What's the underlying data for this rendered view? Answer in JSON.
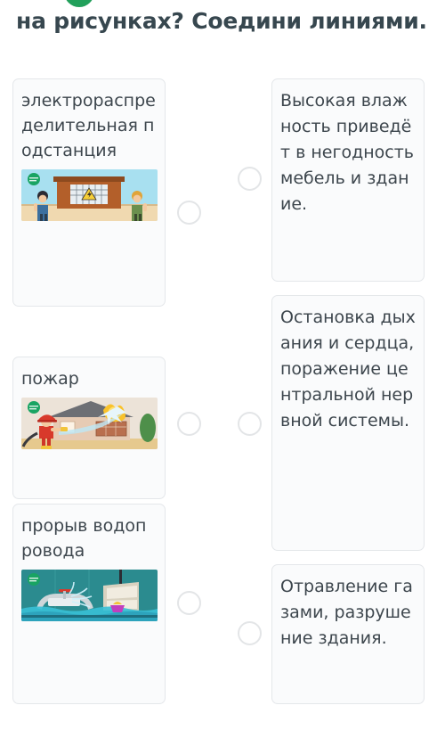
{
  "question": {
    "text": "на рисунках? Соедини линиями."
  },
  "badge": {
    "name": "green-progress-badge",
    "color": "#22a05b"
  },
  "board": {
    "left_column": [
      {
        "label": "электрораспределительная подстанция",
        "image": "electrical-substation-illustration",
        "dot": "connector-dot-left-1"
      },
      {
        "label": "пожар",
        "image": "firefighter-house-fire-illustration",
        "dot": "connector-dot-left-2"
      },
      {
        "label": "прорыв водопровода",
        "image": "burst-water-pipe-flood-illustration",
        "dot": "connector-dot-left-3"
      }
    ],
    "right_column": [
      {
        "text": "Высокая влажность приведёт в негодность мебель и здание.",
        "dot": "connector-dot-right-1"
      },
      {
        "text": "Остановка дыхания и сердца, поражение центральной нервной системы.",
        "dot": "connector-dot-right-2"
      },
      {
        "text": "Отравление газами, разрушение здания.",
        "dot": "connector-dot-right-3"
      }
    ]
  },
  "colors": {
    "text": "#3d464d",
    "heading": "#37474f",
    "card_bg": "#fafbfc",
    "card_border": "#e4e7ea",
    "dot_border": "#e3e5e7",
    "accent_green": "#22a05b"
  }
}
